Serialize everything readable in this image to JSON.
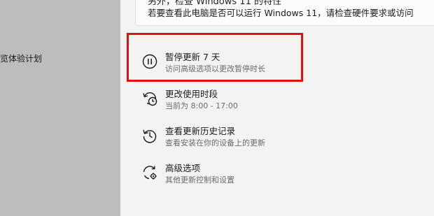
{
  "sidebar": {
    "items": [
      {
        "label": "览体验计划"
      }
    ]
  },
  "main": {
    "info_clipped_text": "另外，检查 Windows 11 的特性",
    "info_text": "若要查看此电脑是否可以运行 Windows 11，请检查硬件要求或访问",
    "options": [
      {
        "title": "暂停更新 7 天",
        "subtitle": "访问高级选项以更改暂停时长",
        "icon": "pause-icon"
      },
      {
        "title": "更改使用时段",
        "subtitle": "当前为 8:00 - 17:00",
        "icon": "active-hours-clock-icon"
      },
      {
        "title": "查看更新历史记录",
        "subtitle": "查看安装在你的设备上的更新",
        "icon": "history-icon"
      },
      {
        "title": "高级选项",
        "subtitle": "其他更新控制和设置",
        "icon": "advanced-options-gear-icon"
      }
    ]
  },
  "colors": {
    "highlight": "#e3100f",
    "sidebar_bg": "#bdbdbd",
    "content_bg": "#f3f3f3"
  }
}
